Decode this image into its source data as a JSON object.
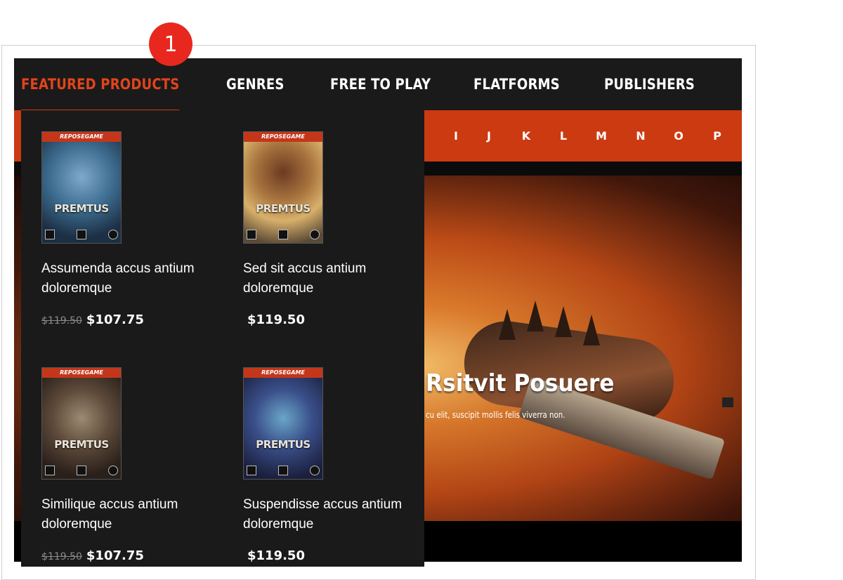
{
  "tutorial": {
    "step_badge": "1"
  },
  "nav": {
    "items": [
      {
        "label": "FEATURED PRODUCTS",
        "active": true
      },
      {
        "label": "GENRES",
        "active": false
      },
      {
        "label": "FREE TO PLAY",
        "active": false
      },
      {
        "label": "FLATFORMS",
        "active": false
      },
      {
        "label": "PUBLISHERS",
        "active": false
      }
    ]
  },
  "alphabet": [
    "I",
    "J",
    "K",
    "L",
    "M",
    "N",
    "O",
    "P"
  ],
  "hero": {
    "title": "Rsitvit Posuere",
    "subtitle": "cu elit, suscipit mollis felis viverra non."
  },
  "featured": {
    "products": [
      {
        "publisher_tag": "REPOSEGAME",
        "cover_title": "PREMTUS",
        "name": "Assumenda accus antium doloremque",
        "old_price": "$119.50",
        "price": "$107.75"
      },
      {
        "publisher_tag": "REPOSEGAME",
        "cover_title": "PREMTUS",
        "name": "Sed sit accus antium doloremque",
        "old_price": "",
        "price": "$119.50"
      },
      {
        "publisher_tag": "REPOSEGAME",
        "cover_title": "PREMTUS",
        "name": "Similique accus antium doloremque",
        "old_price": "$119.50",
        "price": "$107.75"
      },
      {
        "publisher_tag": "REPOSEGAME",
        "cover_title": "PREMTUS",
        "name": "Suspendisse accus antium doloremque",
        "old_price": "",
        "price": "$119.50"
      }
    ]
  },
  "colors": {
    "accent": "#cc3a12",
    "active_nav": "#e0441c",
    "badge": "#e8271e",
    "dark_bg": "#1a1a1a"
  }
}
